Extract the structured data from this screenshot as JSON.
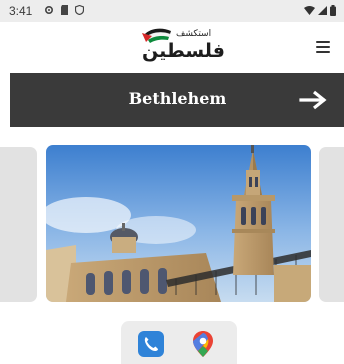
{
  "status_bar": {
    "time": "3:41",
    "icons": [
      "settings-icon",
      "sd-card-icon",
      "shield-icon"
    ],
    "right_icons": [
      "wifi-icon",
      "signal-icon",
      "battery-icon"
    ]
  },
  "header": {
    "logo_small_text": "استكشف",
    "logo_big_text": "فلسطين",
    "menu_icon": "hamburger-menu-icon"
  },
  "title_bar": {
    "city": "Bethlehem",
    "arrow_icon": "arrow-right-icon"
  },
  "gallery": {
    "image": "church-tower-photo"
  },
  "app_icons": {
    "items": [
      "phone-icon",
      "maps-icon"
    ]
  },
  "colors": {
    "title_bar_bg": "#3a3a3a",
    "flag_black": "#1a1a1a",
    "flag_green": "#0d8a3c",
    "flag_red": "#d62828"
  }
}
